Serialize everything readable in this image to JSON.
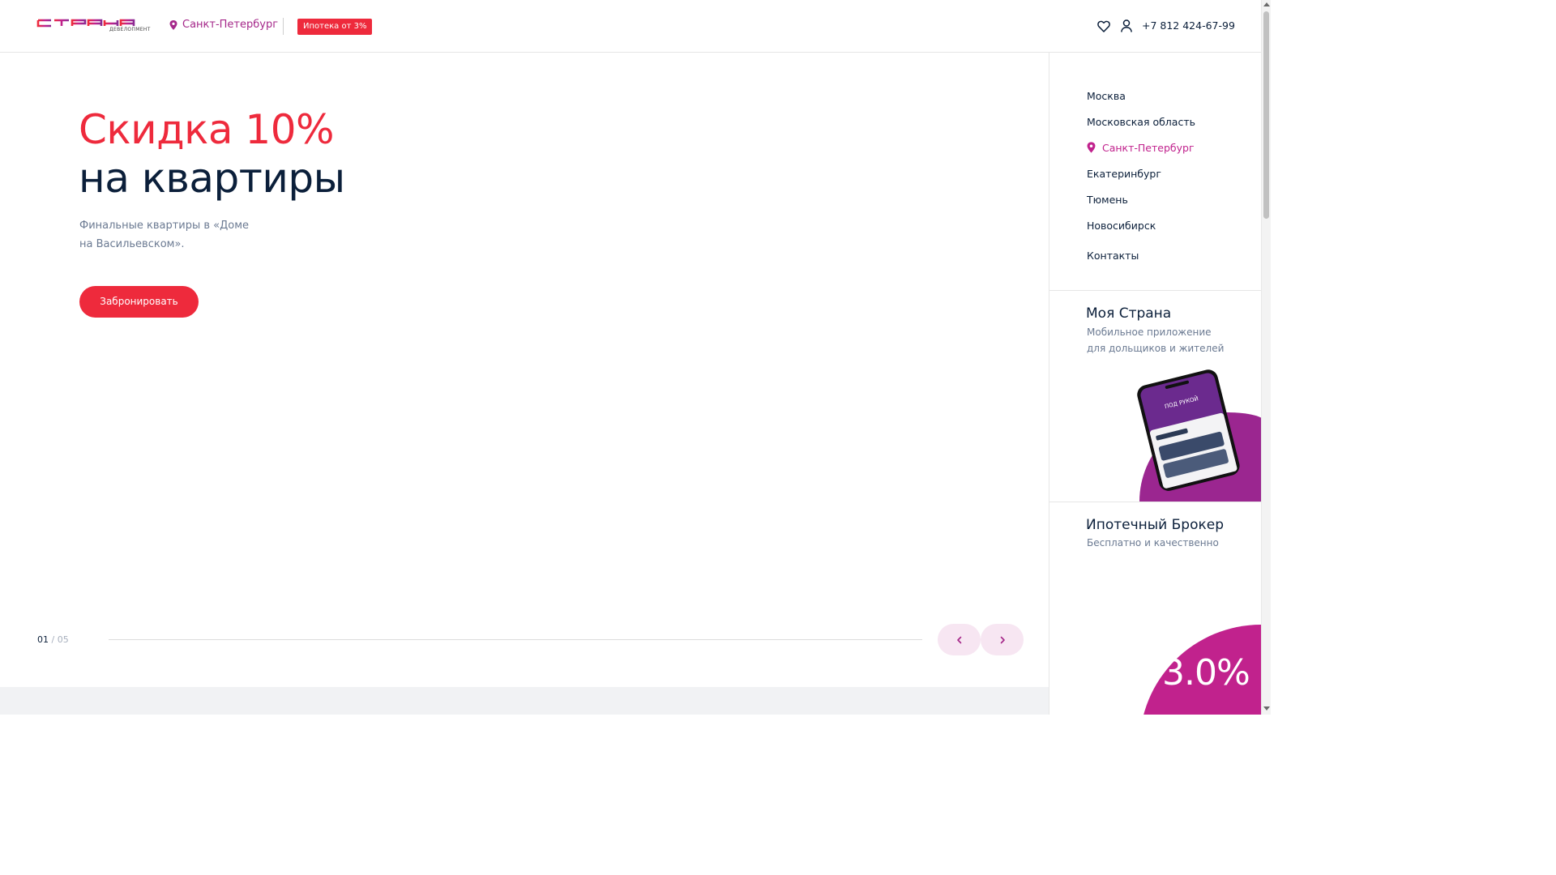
{
  "header": {
    "logo_text": "СТРАНА",
    "logo_subtext": "ДЕВЕЛОПМЕНТ",
    "city": "Санкт-Петербург",
    "mortgage_badge": "Ипотека от 3%",
    "phone": "+7 812 424-67-99",
    "icons": [
      "favorites-heart-icon",
      "user-icon",
      "map-pin-icon"
    ]
  },
  "hero": {
    "title_line1": "Скидка 10%",
    "title_line2": "на квартиры",
    "description": "Финальные квартиры в «Доме на Васильевском».",
    "cta_label": "Забронировать",
    "slide_current": "01",
    "slide_separator": "/",
    "slide_total": "05",
    "progress": 0
  },
  "side_panel": {
    "cities": [
      {
        "label": "Москва",
        "active": false
      },
      {
        "label": "Московская область",
        "active": false
      },
      {
        "label": "Санкт-Петербург",
        "active": true
      },
      {
        "label": "Екатеринбург",
        "active": false
      },
      {
        "label": "Тюмень",
        "active": false
      },
      {
        "label": "Новосибирск",
        "active": false
      }
    ],
    "contacts_label": "Контакты",
    "app_promo": {
      "title": "Моя Страна",
      "description": "Мобильное приложение для дольщиков и жителей",
      "phone_screen_text": "ПОД РУКОЙ"
    },
    "broker_promo": {
      "title": "Ипотечный Брокер",
      "description": "Бесплатно и качественно",
      "rate": "3.0%"
    }
  },
  "colors": {
    "brand_red": "#ee2a3c",
    "brand_magenta": "#c1228d",
    "brand_purple": "#a5288a",
    "text_dark": "#0b1f3a",
    "text_muted": "#6b7a92",
    "nav_button_bg": "#f7e6f2"
  }
}
